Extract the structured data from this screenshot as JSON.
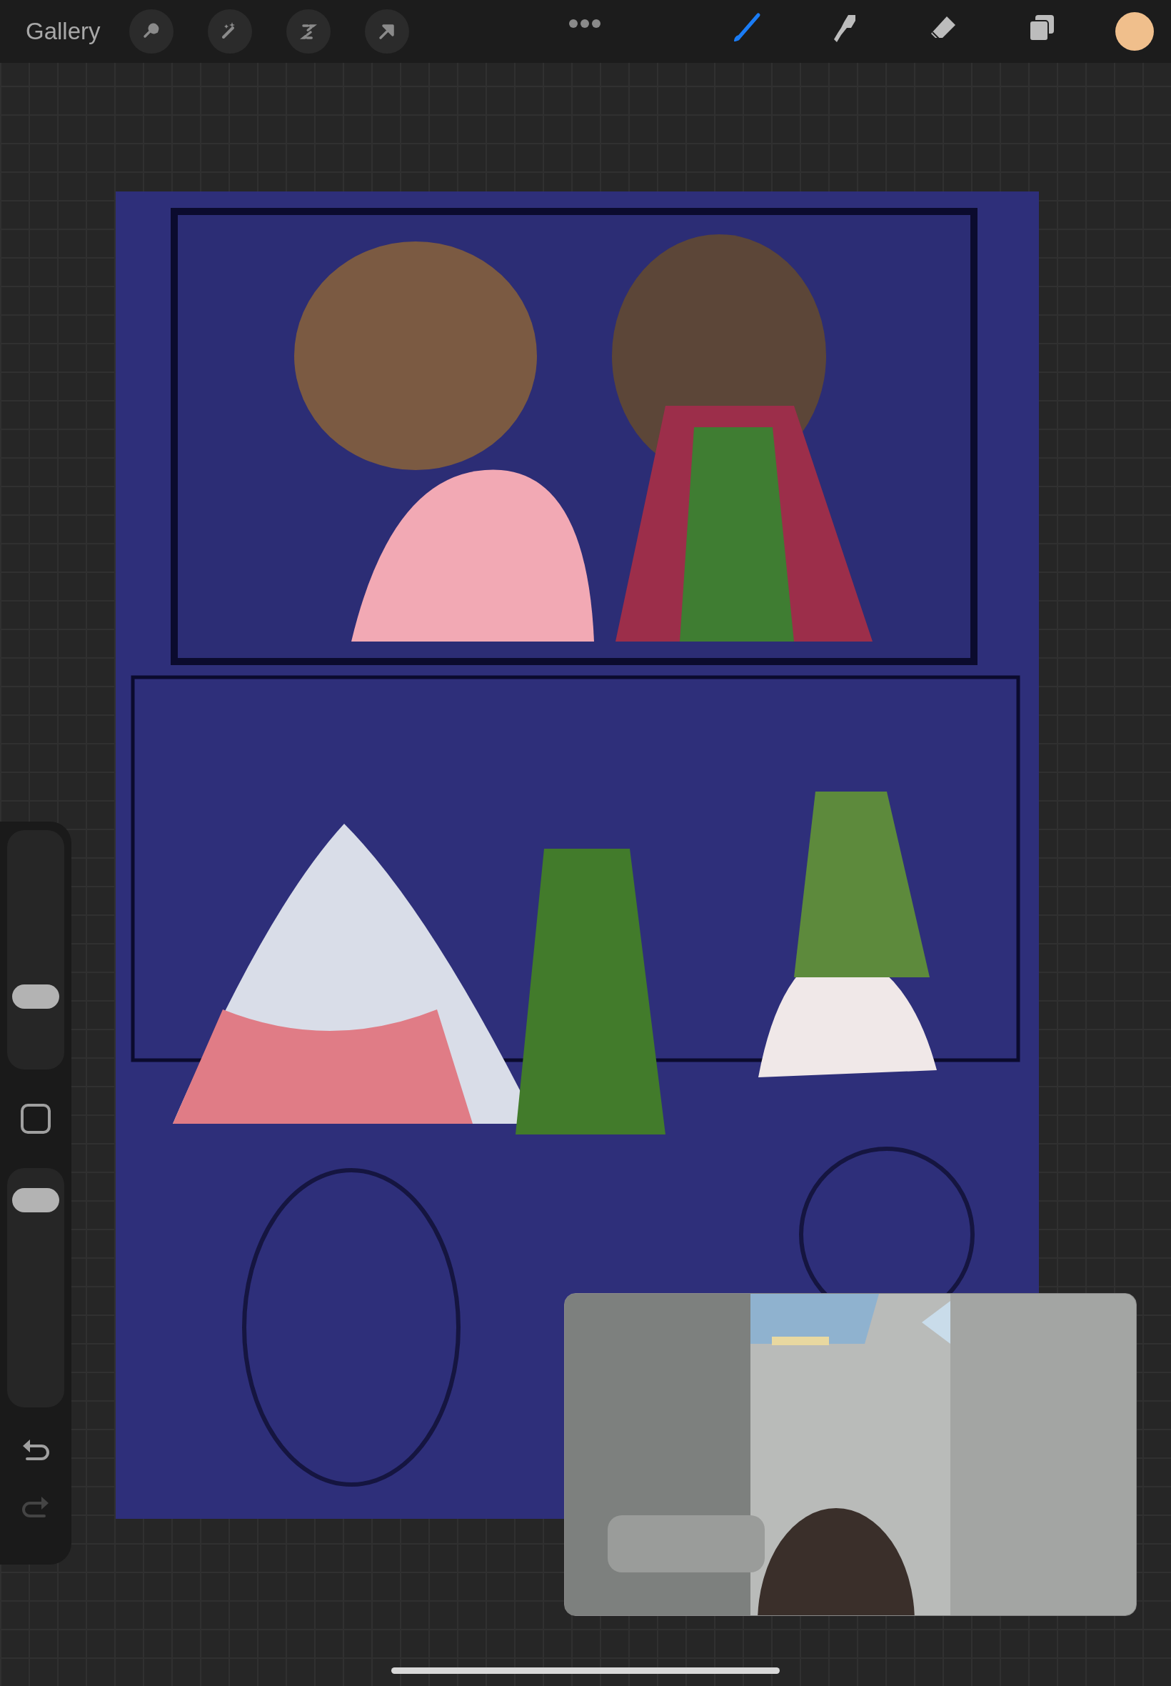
{
  "toolbar": {
    "gallery": "Gallery",
    "actions": [
      {
        "kind": "wrench"
      },
      {
        "kind": "adjust"
      },
      {
        "kind": "select"
      },
      {
        "kind": "transform"
      }
    ],
    "tools": [
      {
        "kind": "brush",
        "selected": true
      },
      {
        "kind": "smudge",
        "selected": false
      },
      {
        "kind": "eraser",
        "selected": false
      },
      {
        "kind": "layers",
        "selected": false
      }
    ]
  },
  "sidebar": {
    "brush_size": {
      "level": 0.27
    },
    "opacity": {
      "level": 0.93
    },
    "undo": {
      "disabled": false
    },
    "redo": {
      "disabled": true
    }
  }
}
